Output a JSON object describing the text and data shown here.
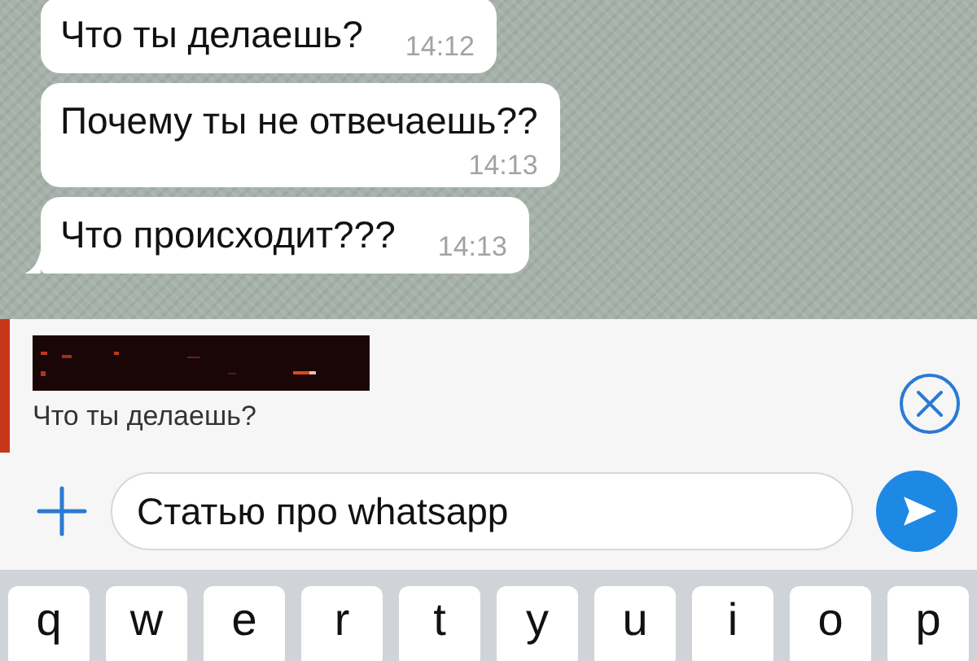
{
  "messages": [
    {
      "text": "Что ты делаешь?",
      "time": "14:12",
      "tail": false,
      "time_below": false
    },
    {
      "text": "Почему ты не отвечаешь??",
      "time": "14:13",
      "tail": false,
      "time_below": true
    },
    {
      "text": "Что происходит???",
      "time": "14:13",
      "tail": true,
      "time_below": false
    }
  ],
  "reply": {
    "quoted_text": "Что ты делаешь?"
  },
  "composer": {
    "value": "Статью про whatsapp"
  },
  "keyboard": {
    "keys": [
      "q",
      "w",
      "e",
      "r",
      "t",
      "y",
      "u",
      "i",
      "o",
      "p"
    ]
  }
}
